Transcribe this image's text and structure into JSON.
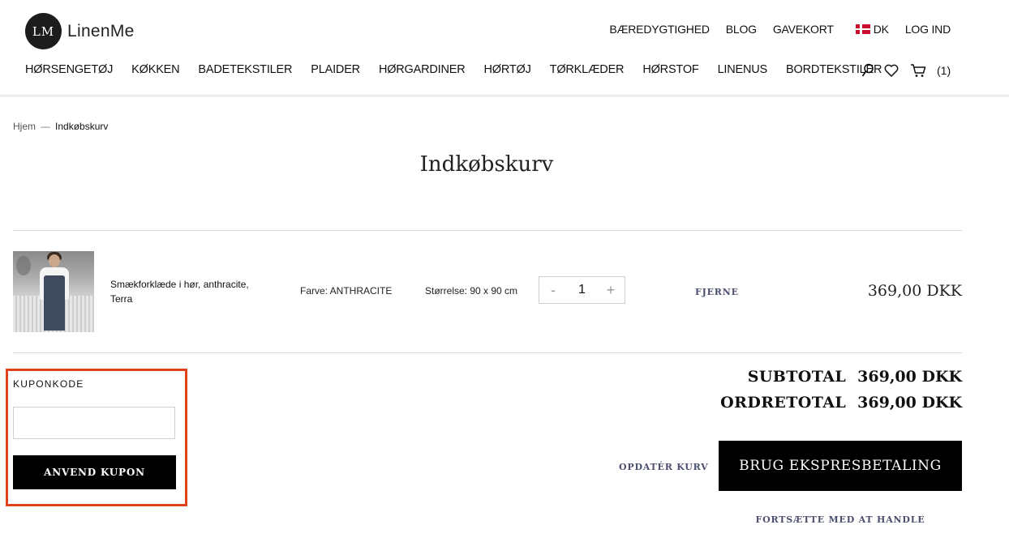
{
  "brand": {
    "mark": "LM",
    "name": "LinenMe"
  },
  "top_links": {
    "sustainability": "BÆREDYGTIGHED",
    "blog": "BLOG",
    "giftcard": "GAVEKORT",
    "country": "DK",
    "login": "LOG IND"
  },
  "nav": [
    "HØRSENGETØJ",
    "KØKKEN",
    "BADETEKSTILER",
    "PLAIDER",
    "HØRGARDINER",
    "HØRTØJ",
    "TØRKLÆDER",
    "HØRSTOF",
    "LINENUS",
    "BORDTEKSTILER"
  ],
  "icons": {
    "search": "search-icon",
    "wishlist": "heart-icon",
    "cart": "cart-icon"
  },
  "cart_count": "(1)",
  "breadcrumb": {
    "home": "Hjem",
    "sep": "—",
    "current": "Indkøbskurv"
  },
  "page_title": "Indkøbskurv",
  "item": {
    "name": "Smækforklæde i hør, anthracite, Terra",
    "color": "Farve: ANTHRACITE",
    "size": "Størrelse: 90 x 90 cm",
    "qty_minus": "-",
    "qty": "1",
    "qty_plus": "+",
    "remove": "FJERNE",
    "price": "369,00 DKK"
  },
  "coupon": {
    "label": "KUPONKODE",
    "placeholder": "",
    "button": "ANVEND KUPON"
  },
  "totals": {
    "subtotal_label": "SUBTOTAL",
    "subtotal_value": "369,00 DKK",
    "ordertotal_label": "ORDRETOTAL",
    "ordertotal_value": "369,00 DKK"
  },
  "actions": {
    "update": "OPDATÉR KURV",
    "express": "BRUG EKSPRESBETALING",
    "continue": "FORTSÆTTE MED AT HANDLE"
  },
  "colors": {
    "accent_link": "#4b4f6e",
    "highlight_border": "#e0431b",
    "button_bg": "#000000"
  }
}
